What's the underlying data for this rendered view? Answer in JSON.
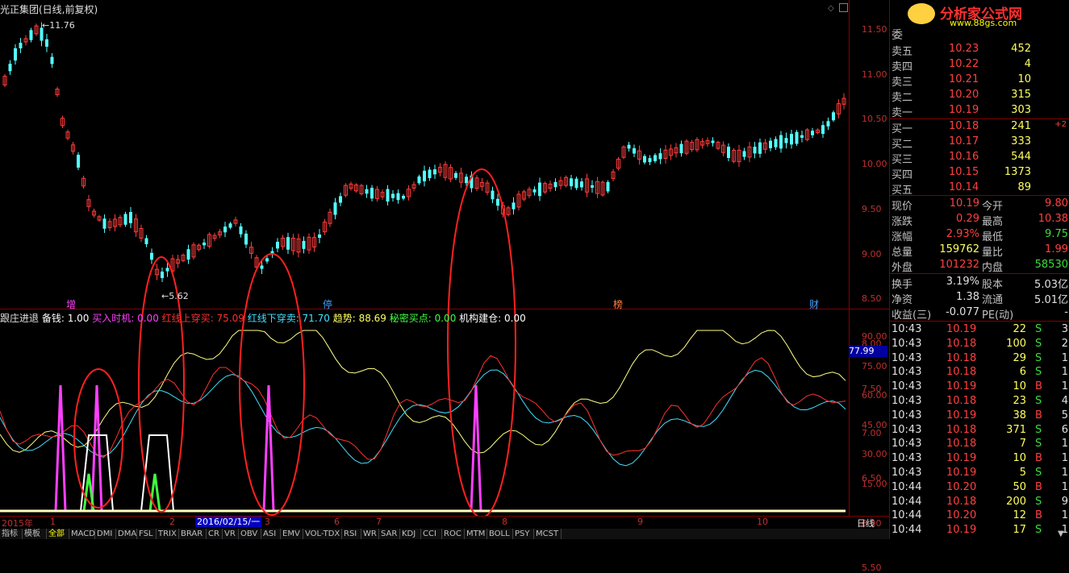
{
  "chart_title": "光正集团(日线,前复权)",
  "price_axis": [
    "11.50",
    "11.00",
    "10.50",
    "10.00",
    "9.50",
    "9.00",
    "8.50",
    "8.00",
    "7.50",
    "7.00",
    "6.50",
    "6.00",
    "5.50"
  ],
  "high_marker": "11.76",
  "low_marker": "5.62",
  "event_flags": [
    "增",
    "停",
    "榜",
    "财"
  ],
  "indicator": {
    "name": "跟庄进退",
    "items": [
      {
        "label": "备钱",
        "value": "1.00",
        "color": "#ffffff"
      },
      {
        "label": "买入时机",
        "value": "0.00",
        "color": "#ff40ff"
      },
      {
        "label": "红线上穿买",
        "value": "75.09",
        "color": "#ff3030"
      },
      {
        "label": "红线下穿卖",
        "value": "71.70",
        "color": "#40e0ff"
      },
      {
        "label": "趋势",
        "value": "88.69",
        "color": "#ffff60"
      },
      {
        "label": "秘密买点",
        "value": "0.00",
        "color": "#40ff40"
      },
      {
        "label": "机构建仓",
        "value": "0.00",
        "color": "#ffffff"
      }
    ],
    "axis": [
      "90.00",
      "75.00",
      "60.00",
      "45.00",
      "30.00",
      "15.00"
    ],
    "current_value": "77.99"
  },
  "time_axis": {
    "year": "2015年",
    "months": [
      "1",
      "2",
      "3",
      "6",
      "7",
      "8",
      "9",
      "10"
    ],
    "highlight_date": "2016/02/15/一"
  },
  "period": "日线",
  "tabs": [
    "指标",
    "模板",
    "全部",
    "MACD",
    "DMI",
    "DMA",
    "FSL",
    "TRIX",
    "BRAR",
    "CR",
    "VR",
    "OBV",
    "ASI",
    "EMV",
    "VOL-TDX",
    "RSI",
    "WR",
    "SAR",
    "KDJ",
    "CCI",
    "ROC",
    "MTM",
    "BOLL",
    "PSY",
    "MCST"
  ],
  "active_tab": "全部",
  "logo": {
    "text": "分析家公式网",
    "url": "www.88gs.com"
  },
  "weibi_label": "委",
  "order_book": {
    "sell": [
      {
        "label": "卖五",
        "price": "10.23",
        "vol": "452"
      },
      {
        "label": "卖四",
        "price": "10.22",
        "vol": "4"
      },
      {
        "label": "卖三",
        "price": "10.21",
        "vol": "10"
      },
      {
        "label": "卖二",
        "price": "10.20",
        "vol": "315"
      },
      {
        "label": "卖一",
        "price": "10.19",
        "vol": "303"
      }
    ],
    "buy": [
      {
        "label": "买一",
        "price": "10.18",
        "vol": "241",
        "chg": "+2"
      },
      {
        "label": "买二",
        "price": "10.17",
        "vol": "333",
        "chg": ""
      },
      {
        "label": "买三",
        "price": "10.16",
        "vol": "544",
        "chg": ""
      },
      {
        "label": "买四",
        "price": "10.15",
        "vol": "1373",
        "chg": ""
      },
      {
        "label": "买五",
        "price": "10.14",
        "vol": "89",
        "chg": ""
      }
    ]
  },
  "quote": [
    {
      "l1": "现价",
      "v1": "10.19",
      "c1": "red",
      "l2": "今开",
      "v2": "9.80",
      "c2": "red"
    },
    {
      "l1": "涨跌",
      "v1": "0.29",
      "c1": "red",
      "l2": "最高",
      "v2": "10.38",
      "c2": "red"
    },
    {
      "l1": "涨幅",
      "v1": "2.93%",
      "c1": "red",
      "l2": "最低",
      "v2": "9.75",
      "c2": "grn"
    },
    {
      "l1": "总量",
      "v1": "159762",
      "c1": "yel",
      "l2": "量比",
      "v2": "1.99",
      "c2": "red"
    },
    {
      "l1": "外盘",
      "v1": "101232",
      "c1": "red",
      "l2": "内盘",
      "v2": "58530",
      "c2": "grn"
    }
  ],
  "fundamentals": [
    {
      "l1": "换手",
      "v1": "3.19%",
      "l2": "股本",
      "v2": "5.03亿"
    },
    {
      "l1": "净资",
      "v1": "1.38",
      "l2": "流通",
      "v2": "5.01亿"
    },
    {
      "l1": "收益(三)",
      "v1": "-0.077",
      "l2": "PE(动)",
      "v2": "-"
    }
  ],
  "ticks": [
    {
      "time": "10:43",
      "price": "10.19",
      "vol": "22",
      "side": "S",
      "n": "3"
    },
    {
      "time": "10:43",
      "price": "10.18",
      "vol": "100",
      "side": "S",
      "n": "2"
    },
    {
      "time": "10:43",
      "price": "10.18",
      "vol": "29",
      "side": "S",
      "n": "1"
    },
    {
      "time": "10:43",
      "price": "10.18",
      "vol": "6",
      "side": "S",
      "n": "1"
    },
    {
      "time": "10:43",
      "price": "10.19",
      "vol": "10",
      "side": "B",
      "n": "1"
    },
    {
      "time": "10:43",
      "price": "10.18",
      "vol": "23",
      "side": "S",
      "n": "4"
    },
    {
      "time": "10:43",
      "price": "10.19",
      "vol": "38",
      "side": "B",
      "n": "5"
    },
    {
      "time": "10:43",
      "price": "10.18",
      "vol": "371",
      "side": "S",
      "n": "6"
    },
    {
      "time": "10:43",
      "price": "10.18",
      "vol": "7",
      "side": "S",
      "n": "1"
    },
    {
      "time": "10:43",
      "price": "10.19",
      "vol": "10",
      "side": "B",
      "n": "1"
    },
    {
      "time": "10:43",
      "price": "10.19",
      "vol": "5",
      "side": "S",
      "n": "1"
    },
    {
      "time": "10:44",
      "price": "10.20",
      "vol": "50",
      "side": "B",
      "n": "1"
    },
    {
      "time": "10:44",
      "price": "10.18",
      "vol": "200",
      "side": "S",
      "n": "9"
    },
    {
      "time": "10:44",
      "price": "10.20",
      "vol": "12",
      "side": "B",
      "n": "1"
    },
    {
      "time": "10:44",
      "price": "10.19",
      "vol": "17",
      "side": "S",
      "n": "1"
    }
  ]
}
